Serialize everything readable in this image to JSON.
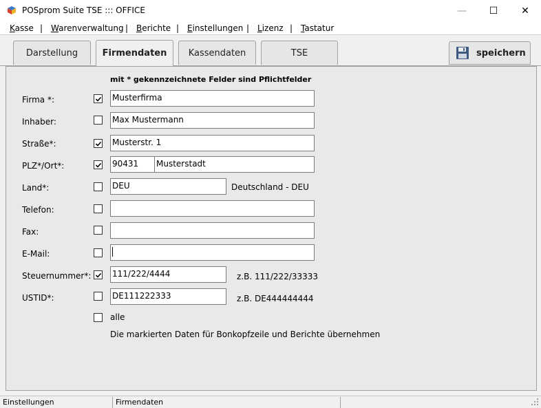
{
  "window": {
    "title": "POSprom Suite TSE ::: OFFICE",
    "minimize": "—",
    "maximize": "☐",
    "close": "✕"
  },
  "menu": [
    {
      "u": "K",
      "rest": "asse"
    },
    {
      "u": "W",
      "rest": "arenverwaltung"
    },
    {
      "u": "B",
      "rest": "erichte"
    },
    {
      "u": "E",
      "rest": "instellungen"
    },
    {
      "u": "L",
      "rest": "izenz"
    },
    {
      "u": "T",
      "rest": "astatur"
    }
  ],
  "menu_separator": "|",
  "tabs": [
    {
      "label": "Darstellung",
      "active": false
    },
    {
      "label": "Firmendaten",
      "active": true
    },
    {
      "label": "Kassendaten",
      "active": false
    },
    {
      "label": "TSE",
      "active": false
    }
  ],
  "save_button": {
    "label": "speichern",
    "icon": "floppy-disk-icon"
  },
  "required_note": "mit * gekennzeichnete Felder sind Pflichtfelder",
  "fields": {
    "firma": {
      "label": "Firma *:",
      "checked": true,
      "value": "Musterfirma"
    },
    "inhaber": {
      "label": "Inhaber:",
      "checked": false,
      "value": "Max Mustermann"
    },
    "strasse": {
      "label": "Straße*:",
      "checked": true,
      "value": "Musterstr. 1"
    },
    "plzort": {
      "label": "PLZ*/Ort*:",
      "checked": true,
      "plz": "90431",
      "ort": "Musterstadt"
    },
    "land": {
      "label": "Land*:",
      "checked": false,
      "value": "DEU",
      "hint": "Deutschland - DEU"
    },
    "telefon": {
      "label": "Telefon:",
      "checked": false,
      "value": ""
    },
    "fax": {
      "label": "Fax:",
      "checked": false,
      "value": ""
    },
    "email": {
      "label": "E-Mail:",
      "checked": false,
      "value": ""
    },
    "steuer": {
      "label": "Steuernummer*:",
      "checked": true,
      "value": "111/222/4444",
      "hint": "z.B. 111/222/33333"
    },
    "ustid": {
      "label": "USTID*:",
      "checked": false,
      "value": "DE111222333",
      "hint": "z.B. DE444444444"
    }
  },
  "alle": {
    "label": "alle",
    "checked": false
  },
  "transfer_note": "Die markierten Daten für Bonkopfzeile und Berichte übernehmen",
  "status": {
    "left": "Einstellungen",
    "right": "Firmendaten"
  }
}
